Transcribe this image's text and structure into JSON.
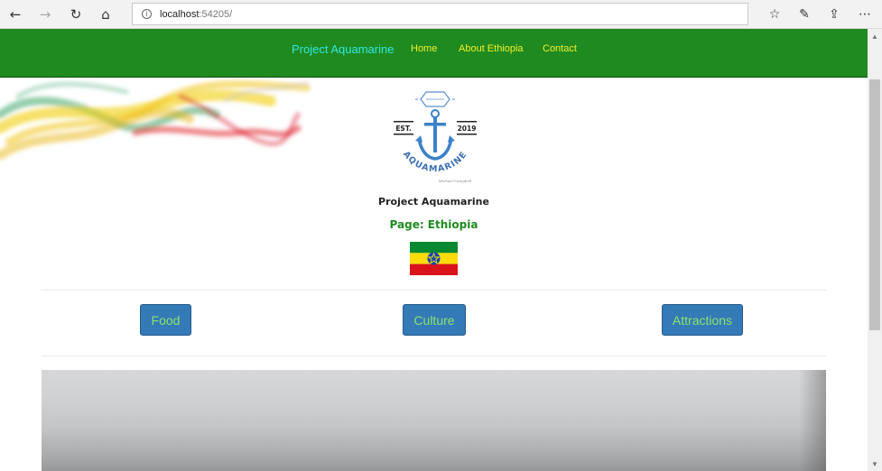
{
  "browser": {
    "url_host": "localhost",
    "url_port": ":54205/",
    "icons": [
      "back-icon",
      "forward-icon",
      "refresh-icon",
      "home-icon",
      "info-icon",
      "favorites-icon",
      "pen-icon",
      "share-icon",
      "more-icon"
    ]
  },
  "navbar": {
    "brand": "Project Aquamarine",
    "links": [
      "Home",
      "About Ethiopia",
      "Contact"
    ],
    "colors": {
      "background": "#1f8a1f",
      "brand": "#33e8e0",
      "link": "#f2ef2a"
    }
  },
  "logo": {
    "est": "EST.",
    "year": "2019",
    "arc_text": "AQUAMARINE",
    "signature": "Michael Campbell"
  },
  "header": {
    "site_title": "Project Aquamarine",
    "page_label": "Page: Ethiopia"
  },
  "categories": [
    "Food",
    "Culture",
    "Attractions"
  ],
  "colors": {
    "button_bg": "#337ab7",
    "button_text": "#8ee36b",
    "flag": [
      "#078930",
      "#fcdd09",
      "#da121a",
      "#0f47af"
    ]
  }
}
